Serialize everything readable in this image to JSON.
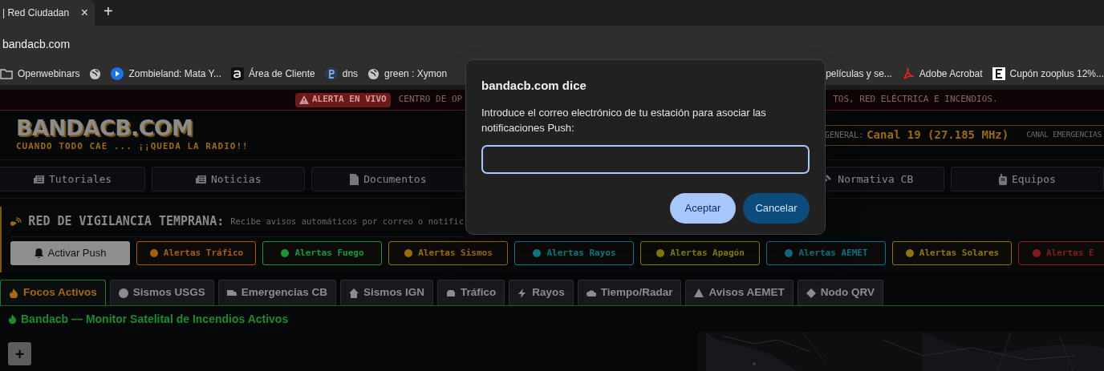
{
  "browser": {
    "tabs": [
      {
        "title": "| Red Ciudadan",
        "selected": true,
        "close": "×"
      }
    ],
    "new_tab": "+",
    "address": "bandacb.com",
    "bookmarks": [
      {
        "kind": "folder",
        "label": "Openwebinars"
      },
      {
        "kind": "globe"
      },
      {
        "kind": "play",
        "label": "Zombieland: Mata Y..."
      },
      {
        "kind": "a-logo",
        "label": "Área de Cliente"
      },
      {
        "kind": "p-logo",
        "label": "dns"
      },
      {
        "kind": "globe",
        "label": "green : Xymon"
      },
      {
        "kind": "plain",
        "label": "películas y se..."
      },
      {
        "kind": "pdf",
        "label": "Adobe Acrobat"
      },
      {
        "kind": "e-logo",
        "label": "Cupón zooplus 12%..."
      }
    ]
  },
  "alert_bar": {
    "badge": "ALERTA EN VIVO",
    "text_left": "CENTRO DE OP",
    "text_right": "TOS, RED ELÉCTRICA E INCENDIOS."
  },
  "header": {
    "logo": "BANDACB.COM",
    "tagline": "CUANDO TODO CAE ... ¡¡QUEDA LA RADIO!!",
    "channel_label": "GENERAL:",
    "channel_value": "Canal 19 (27.185 MHz)",
    "emergency_label": "CANAL EMERGENCIAS"
  },
  "nav": [
    {
      "label": "Tutoriales"
    },
    {
      "label": "Noticias"
    },
    {
      "label": "Documentos"
    },
    {
      "label": "Normativa CB"
    },
    {
      "label": "Equipos"
    }
  ],
  "vigilance": {
    "title": "RED DE VIGILANCIA TEMPRANA:",
    "description": "Recibe avisos automáticos por correo o notific",
    "buttons": [
      {
        "kind": "primary",
        "label": "Activar Push"
      },
      {
        "kind": "alert",
        "label": "Alertas Tráfico",
        "color": "#a85c12"
      },
      {
        "kind": "alert",
        "label": "Alertas Fuego",
        "color": "#1c9634"
      },
      {
        "kind": "alert",
        "label": "Alertas Sismos",
        "color": "#9a6c10"
      },
      {
        "kind": "alert",
        "label": "Alertas Rayos",
        "color": "#14808a"
      },
      {
        "kind": "alert",
        "label": "Alertas Apagón",
        "color": "#86830e"
      },
      {
        "kind": "alert",
        "label": "Alertas AEMET",
        "color": "#146f86"
      },
      {
        "kind": "alert",
        "label": "Alertas Solares",
        "color": "#8f7410"
      },
      {
        "kind": "alert",
        "label": "Alertas E",
        "color": "#7e1d1d"
      }
    ]
  },
  "tabs": [
    {
      "label": "Focos Activos",
      "selected": true
    },
    {
      "label": "Sismos USGS",
      "selected": false
    },
    {
      "label": "Emergencias CB",
      "selected": false
    },
    {
      "label": "Sismos IGN",
      "selected": false
    },
    {
      "label": "Tráfico",
      "selected": false
    },
    {
      "label": "Rayos",
      "selected": false
    },
    {
      "label": "Tiempo/Radar",
      "selected": false
    },
    {
      "label": "Avisos AEMET",
      "selected": false
    },
    {
      "label": "Nodo QRV",
      "selected": false
    }
  ],
  "section_title": "Bandacb — Monitor Satelital de Incendios Activos",
  "map": {
    "kind": "picture",
    "zoom_in": "+"
  },
  "dialog": {
    "title": "bandacb.com dice",
    "message": "Introduce el correo electrónico de tu estación para asociar las notificaciones Push:",
    "buttons": [
      {
        "label": "Aceptar",
        "kind": "primary"
      },
      {
        "label": "Cancelar",
        "kind": "secondary"
      }
    ]
  }
}
